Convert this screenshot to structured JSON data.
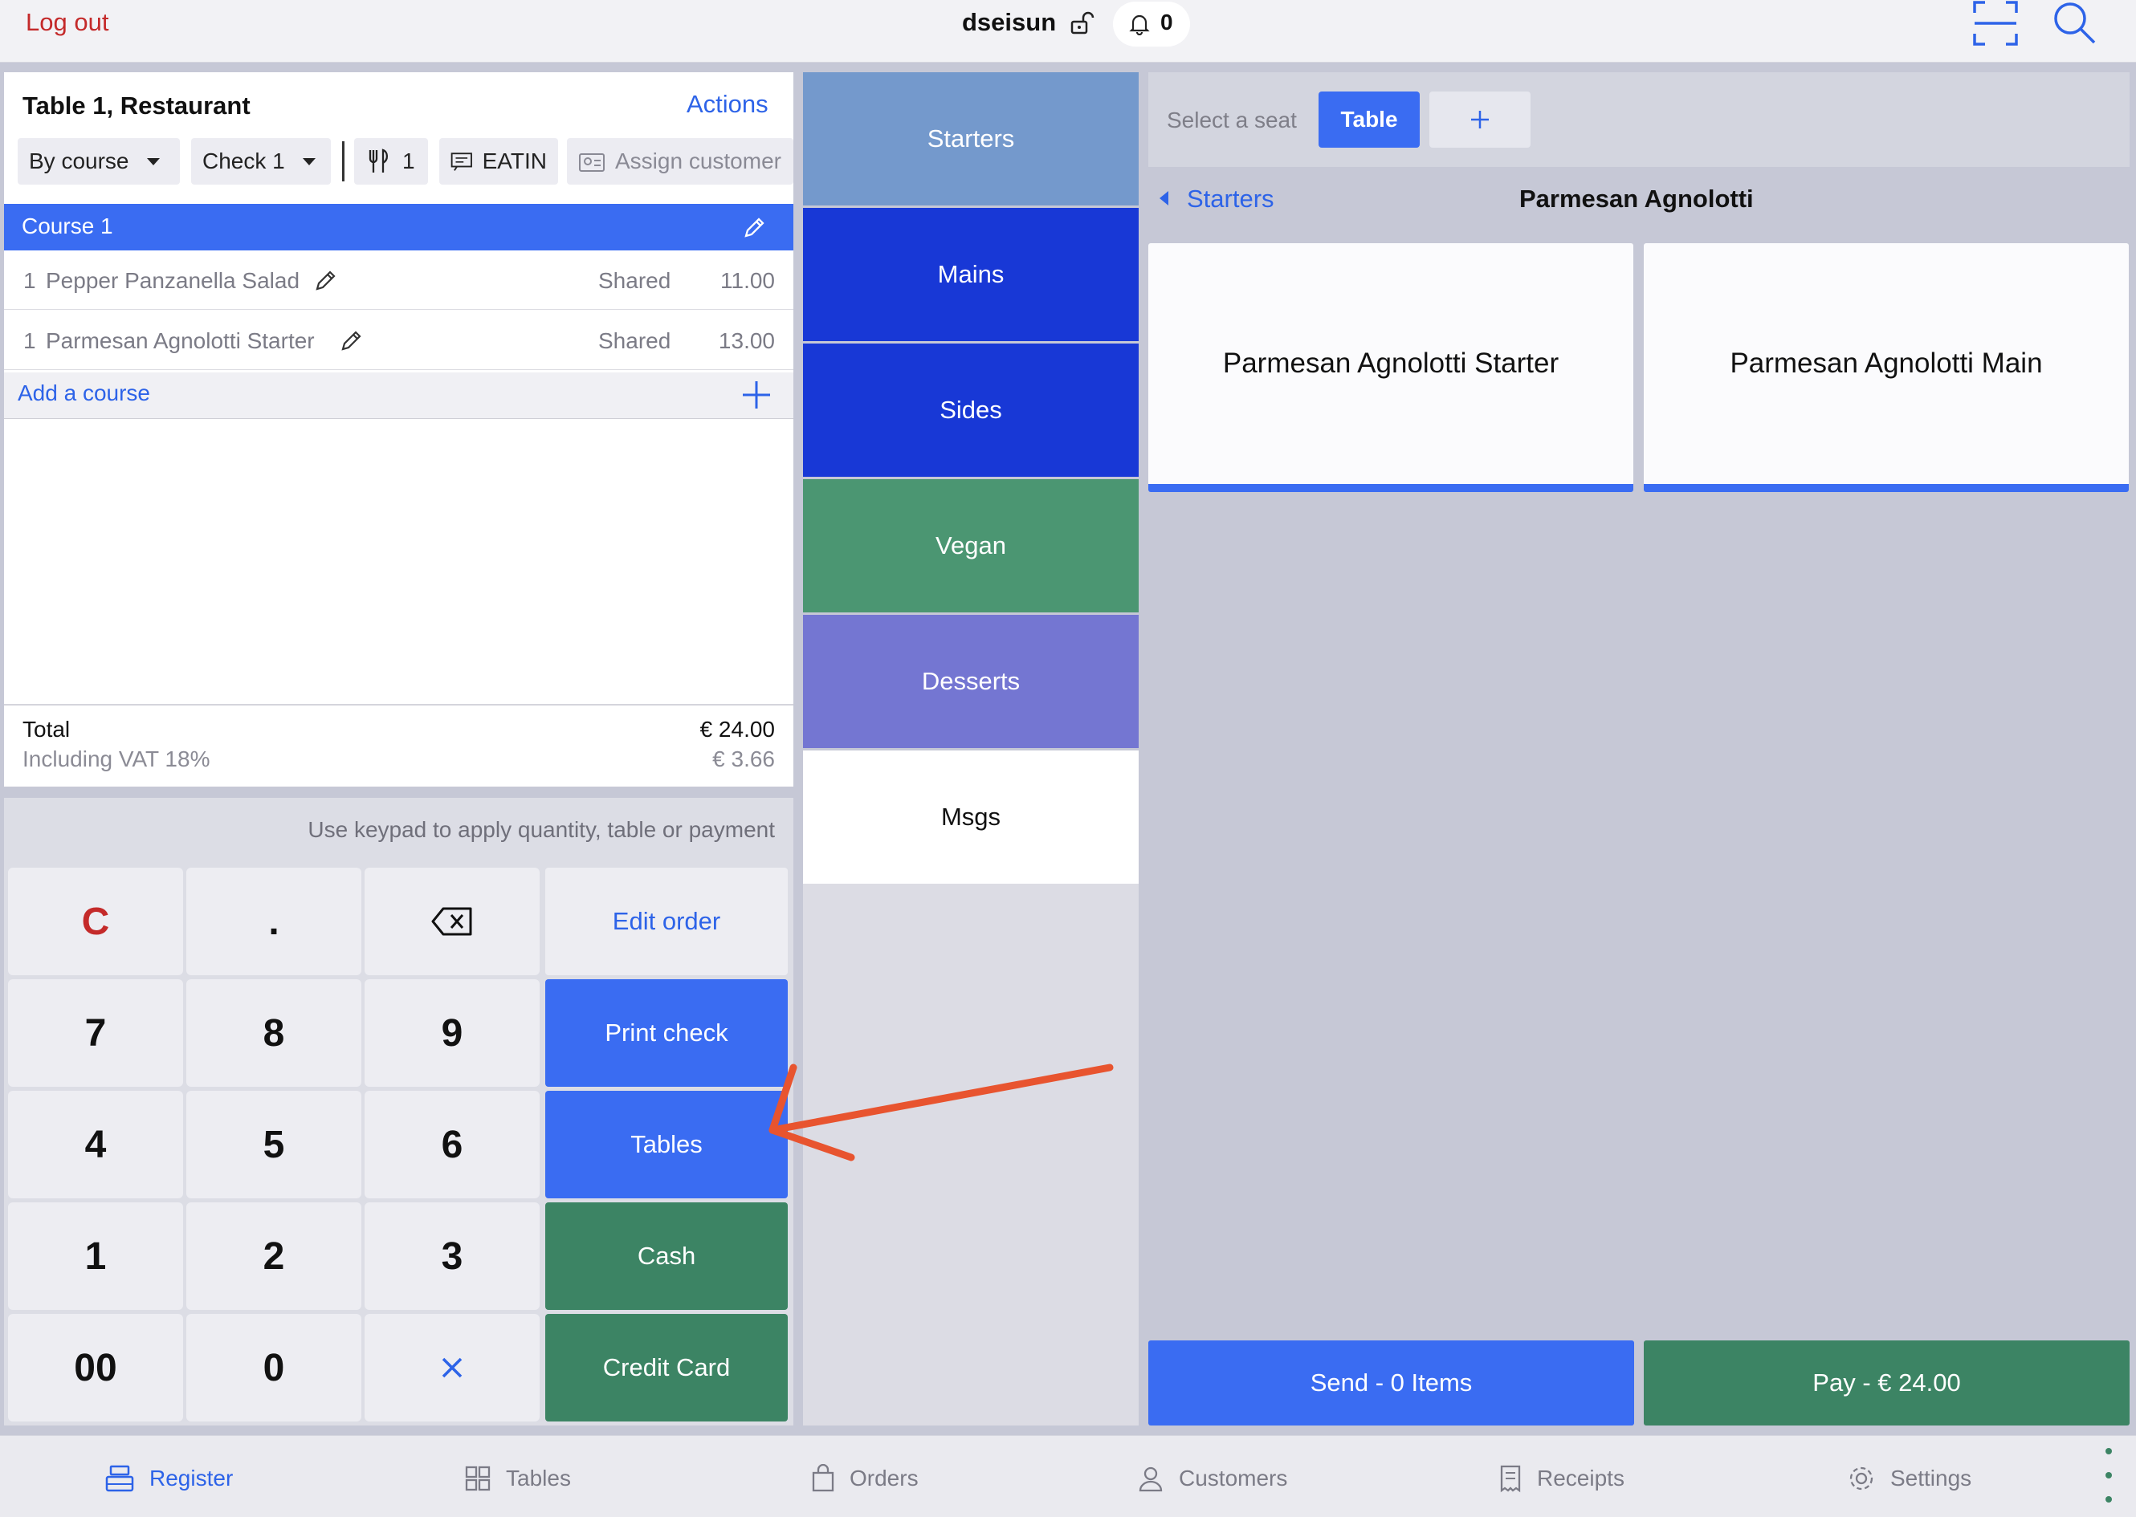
{
  "topbar": {
    "logout": "Log out",
    "username": "dseisun",
    "notifications": "0"
  },
  "order": {
    "title": "Table 1, Restaurant",
    "actions": "Actions",
    "mode": "By course",
    "check": "Check 1",
    "covers": "1",
    "dining": "EATIN",
    "assign_customer": "Assign customer",
    "course": "Course 1",
    "items": [
      {
        "qty": "1",
        "name": "Pepper Panzanella Salad",
        "seat": "Shared",
        "price": "11.00"
      },
      {
        "qty": "1",
        "name": "Parmesan Agnolotti Starter",
        "seat": "Shared",
        "price": "13.00"
      }
    ],
    "add_course": "Add a course",
    "total_label": "Total",
    "total_value": "€ 24.00",
    "vat_label": "Including VAT 18%",
    "vat_value": "€ 3.66"
  },
  "keypad": {
    "hint": "Use keypad to apply quantity, table or payment",
    "keys": [
      "C",
      ".",
      "7",
      "8",
      "9",
      "4",
      "5",
      "6",
      "1",
      "2",
      "3",
      "00",
      "0"
    ],
    "edit_order": "Edit order",
    "print_check": "Print check",
    "tables": "Tables",
    "cash": "Cash",
    "credit_card": "Credit Card"
  },
  "categories": [
    {
      "label": "Starters",
      "color": "#7499cc"
    },
    {
      "label": "Mains",
      "color": "#1838d6"
    },
    {
      "label": "Sides",
      "color": "#1838d6"
    },
    {
      "label": "Vegan",
      "color": "#4b9672"
    },
    {
      "label": "Desserts",
      "color": "#7476d2"
    },
    {
      "label": "Msgs",
      "color": "#ffffff"
    }
  ],
  "menu": {
    "seat_label": "Select a seat",
    "seat_table": "Table",
    "back": "Starters",
    "title": "Parmesan Agnolotti",
    "products": [
      "Parmesan Agnolotti Starter",
      "Parmesan Agnolotti Main"
    ],
    "send": "Send - 0 Items",
    "pay": "Pay - € 24.00"
  },
  "nav": {
    "register": "Register",
    "tables": "Tables",
    "orders": "Orders",
    "customers": "Customers",
    "receipts": "Receipts",
    "settings": "Settings"
  },
  "colors": {
    "accent": "#3a6cf2",
    "pay_green": "#3c8464",
    "logout_red": "#c42a2a",
    "annotation_arrow": "#e8542f"
  }
}
